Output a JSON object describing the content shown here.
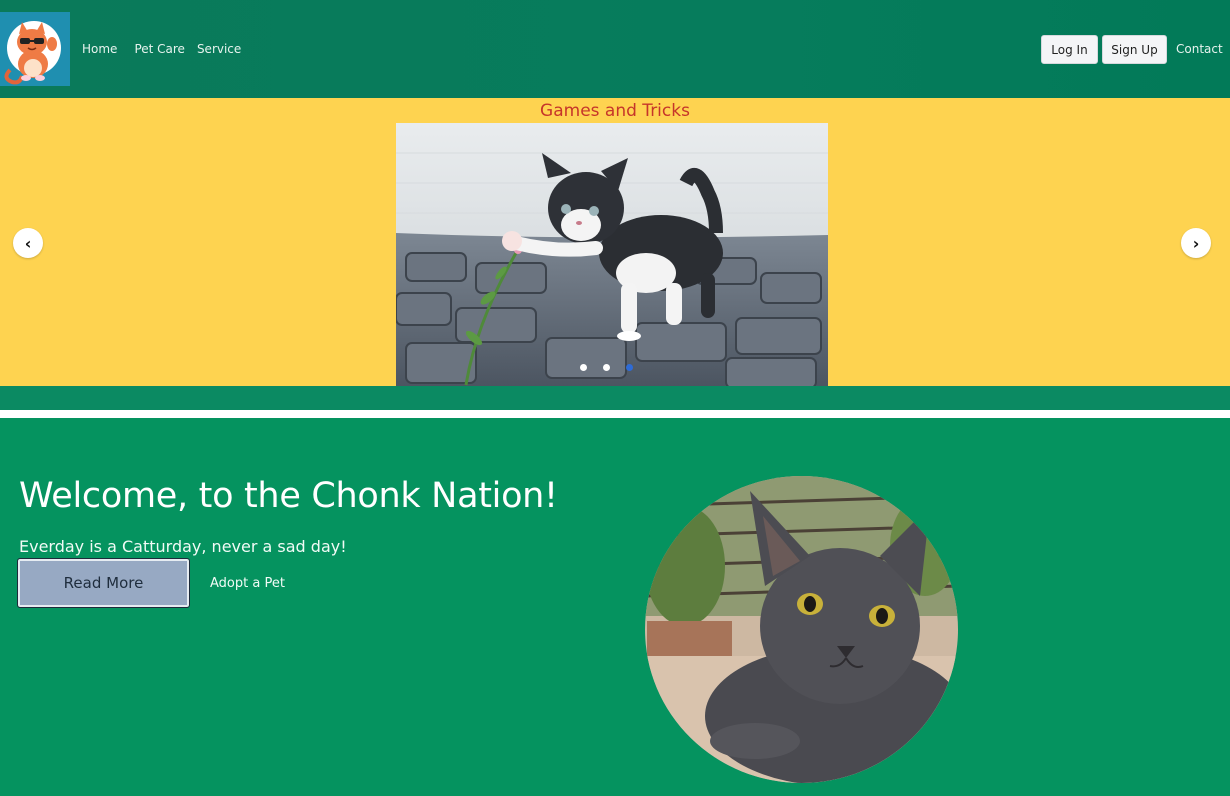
{
  "nav": {
    "logo_icon": "cat-logo-icon",
    "links": [
      "Home",
      "Pet Care",
      "Service"
    ],
    "login_label": "Log In",
    "signup_label": "Sign Up",
    "contact_label": "Contact"
  },
  "carousel": {
    "title": "Games and Tricks",
    "image_icon": "kitten-photo",
    "prev_icon": "chevron-left-icon",
    "next_icon": "chevron-right-icon",
    "prev_glyph": "‹",
    "next_glyph": "›",
    "slide_count": 3,
    "active_index": 2
  },
  "hero": {
    "title": "Welcome, to the Chonk Nation!",
    "subtitle": "Everday is a Catturday, never a sad day!",
    "read_more_label": "Read More",
    "adopt_label": "Adopt a Pet",
    "photo_icon": "grey-cat-photo"
  },
  "colors": {
    "navbar": "#067c5c",
    "carousel_bg": "#fed350",
    "carousel_title": "#c6352a",
    "hero_bg": "#05935f",
    "read_more_bg": "#97a9c3",
    "active_dot": "#2e6bd6"
  }
}
